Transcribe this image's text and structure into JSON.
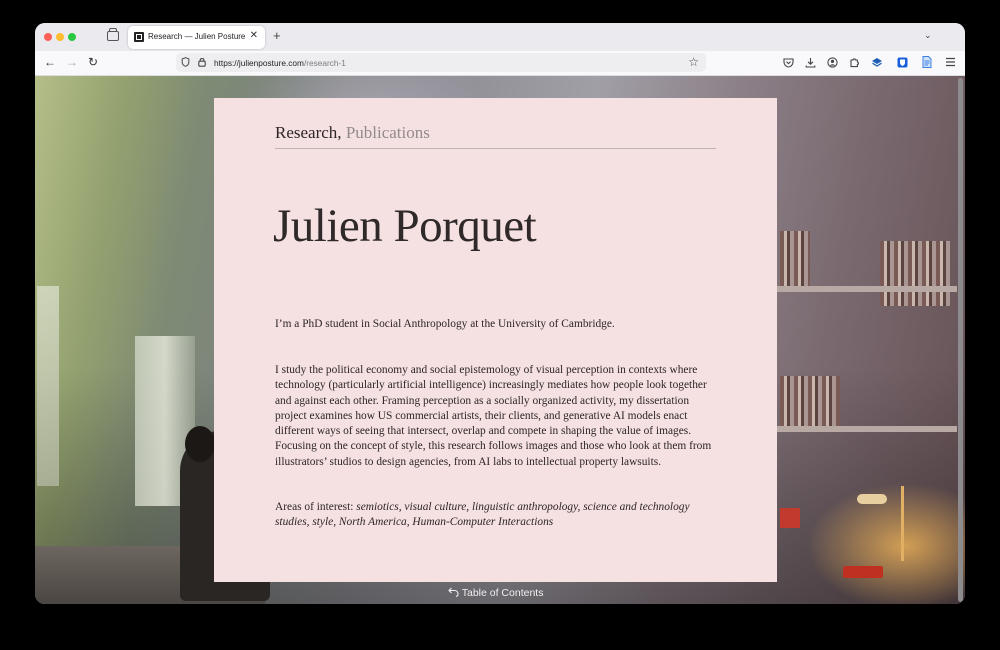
{
  "browser": {
    "tab_title": "Research — Julien Posture",
    "new_tab_symbol": "+",
    "tab_close_symbol": "✕",
    "url_host": "https://julienposture.com",
    "url_path": "/research-1"
  },
  "page": {
    "nav_research": "Research,",
    "nav_publications": "Publications",
    "name": "Julien Porquet",
    "intro": "I’m a PhD student in Social Anthropology at the University of Cambridge.",
    "research_description": "I study the political economy and social epistemology of visual perception in contexts where technology (particularly artificial intelligence) increasingly mediates how people look together and against each other. Framing perception as a socially organized activity, my dissertation project examines how US commercial artists, their clients, and generative AI models enact different ways of seeing that intersect, overlap and compete in shaping the value of images. Focusing on the concept of style, this research follows images and those who look at them from illustrators’ studios to design agencies, from AI labs to intellectual property lawsuits.",
    "interests_label": "Areas of interest: ",
    "interests": "semiotics, visual culture, linguistic anthropology, science and technology studies, style, North America, Human-Computer Interactions",
    "toc_label": "Table of Contents"
  },
  "colors": {
    "card_background": "#f5e1e2",
    "text": "#2d2526",
    "muted_nav": "#938a8b"
  },
  "icons": {
    "toc": "back-arrow-icon"
  }
}
